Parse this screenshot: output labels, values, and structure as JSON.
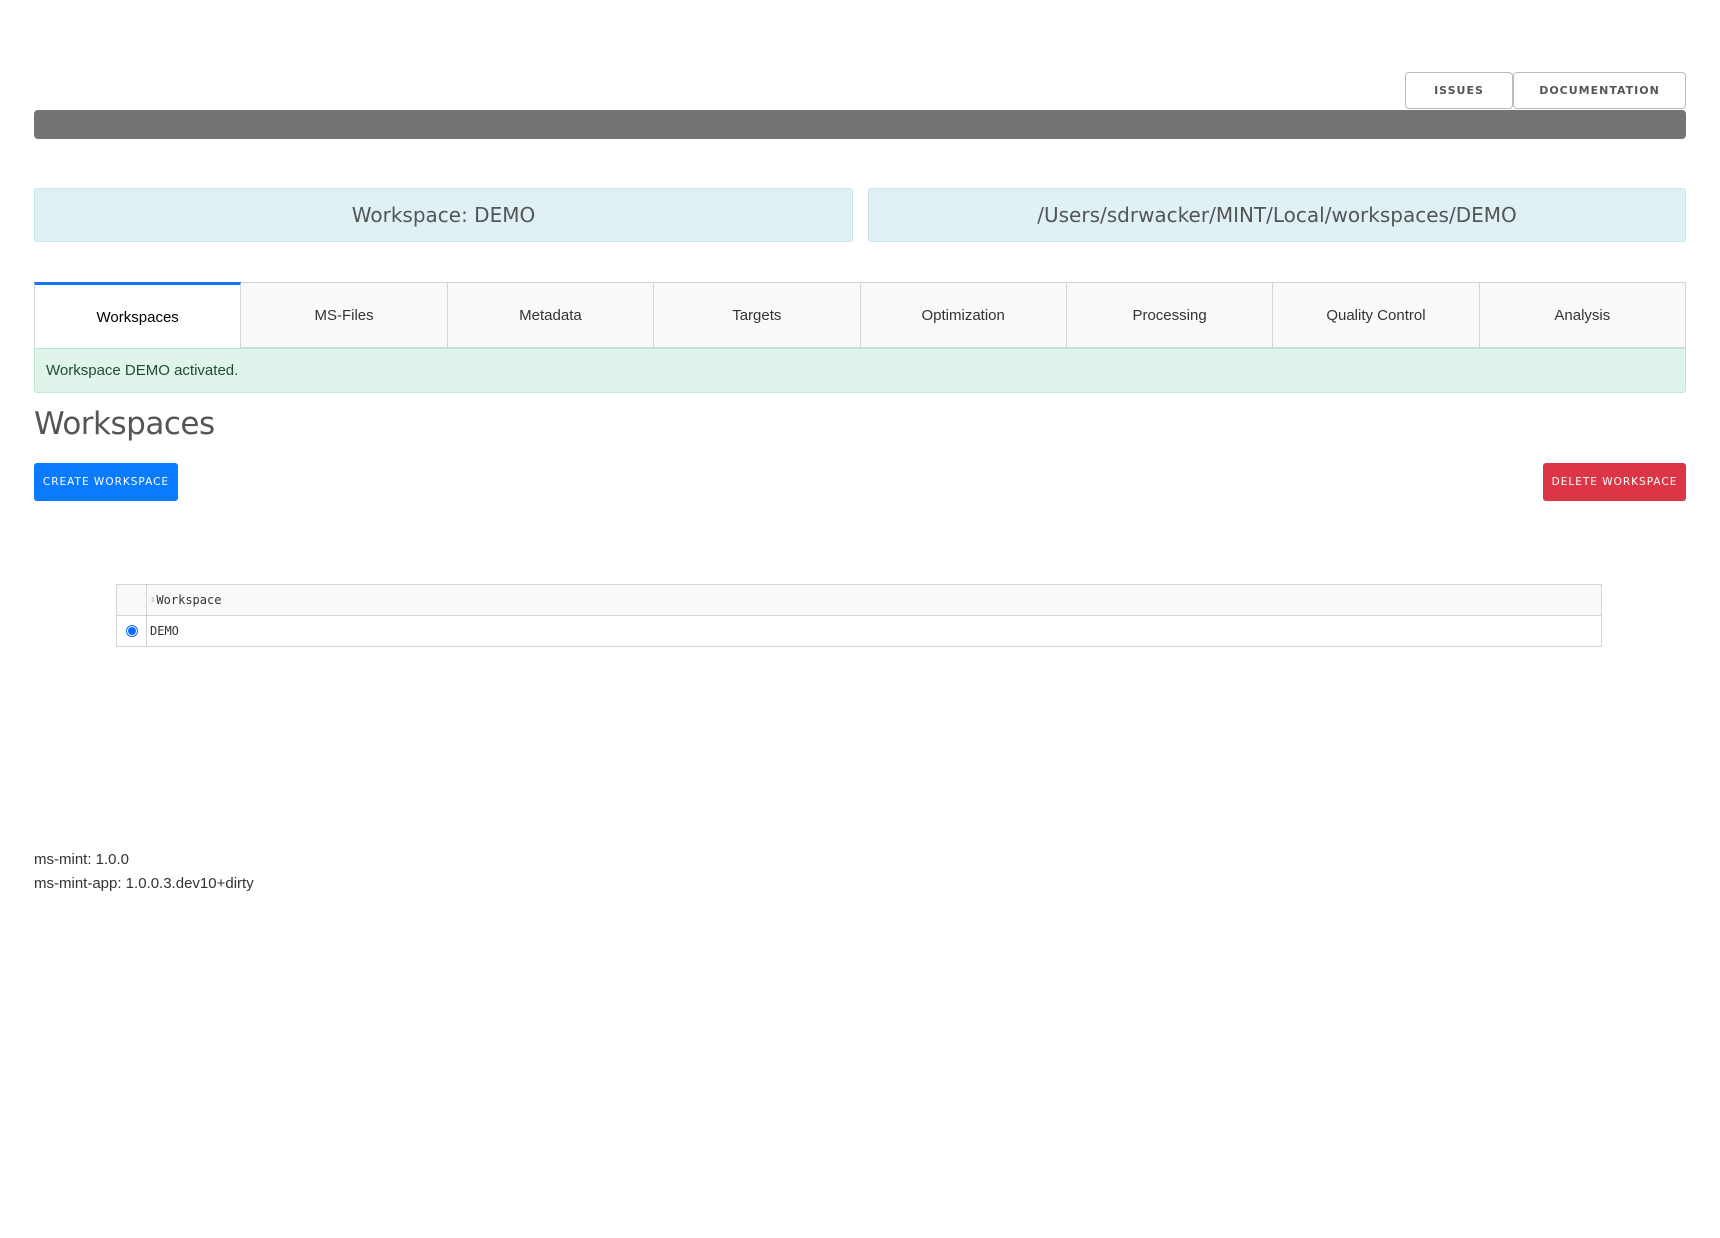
{
  "header": {
    "buttons": [
      {
        "label": "ISSUES"
      },
      {
        "label": "DOCUMENTATION"
      }
    ],
    "progress": {
      "value_percent": 100,
      "color": "#747474"
    }
  },
  "workspace_info": {
    "name_text": "Workspace: DEMO",
    "path_text": "/Users/sdrwacker/MINT/Local/workspaces/DEMO"
  },
  "tabs": [
    {
      "label": "Workspaces",
      "active": true
    },
    {
      "label": "MS-Files"
    },
    {
      "label": "Metadata"
    },
    {
      "label": "Targets"
    },
    {
      "label": "Optimization"
    },
    {
      "label": "Processing"
    },
    {
      "label": "Quality Control"
    },
    {
      "label": "Analysis"
    }
  ],
  "alert": {
    "text": "Workspace DEMO activated."
  },
  "main": {
    "title": "Workspaces",
    "create_label": "CREATE WORKSPACE",
    "delete_label": "DELETE WORKSPACE",
    "table": {
      "columns": [
        {
          "label": "Workspace",
          "sortable": true
        }
      ],
      "rows": [
        {
          "workspace": "DEMO",
          "selected": true
        }
      ]
    }
  },
  "footer": {
    "versions": [
      "ms-mint: 1.0.0",
      "ms-mint-app: 1.0.0.3.dev10+dirty"
    ]
  },
  "colors": {
    "accent": "#1975fa",
    "create": "#0a7bff",
    "delete": "#dc3545",
    "info_bg": "#e0f1f6",
    "success_bg": "#dff4ea"
  }
}
